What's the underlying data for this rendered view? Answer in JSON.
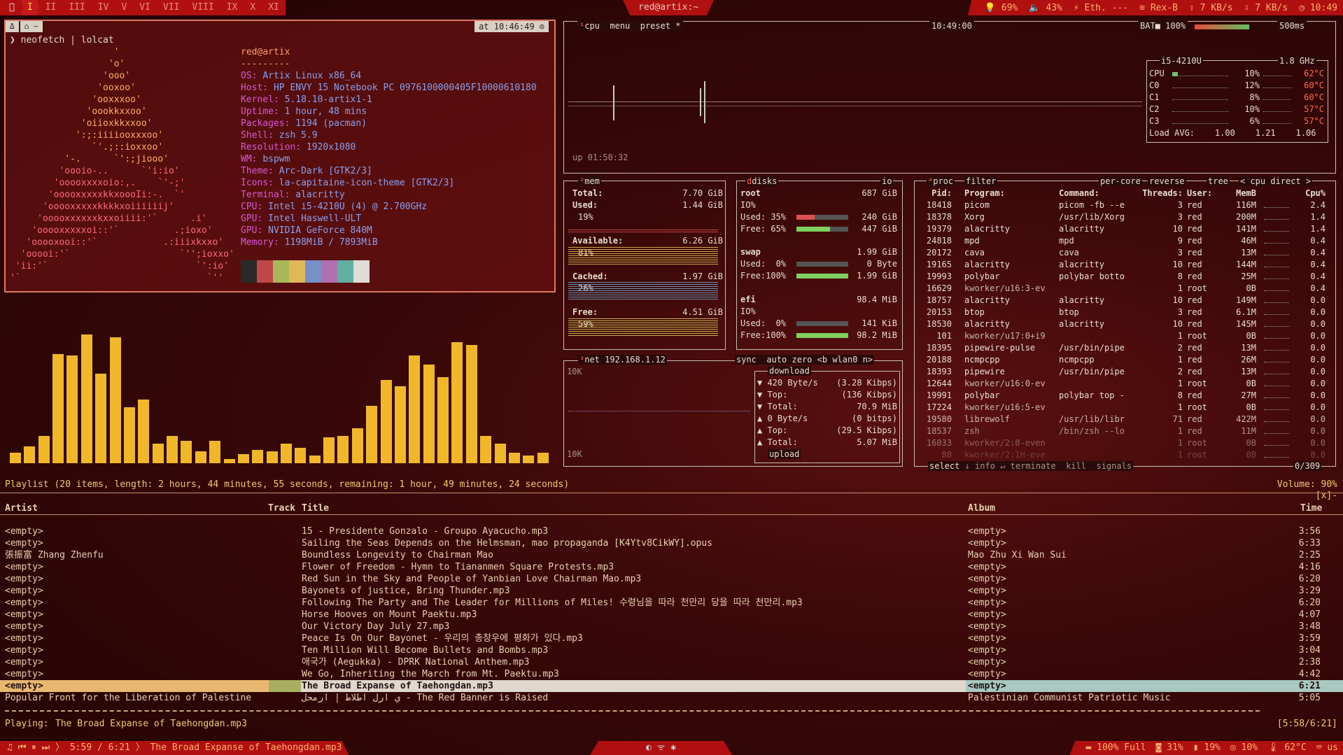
{
  "topbar": {
    "workspace_icon": "󰣇",
    "workspaces": [
      "I",
      "II",
      "III",
      "IV",
      "V",
      "VI",
      "VII",
      "VIII",
      "IX",
      "X",
      "XI"
    ],
    "active_workspace": "I",
    "window_title": "red@artix:~",
    "modules": [
      {
        "icon": "bulb-icon",
        "text": "69%"
      },
      {
        "icon": "speaker-icon",
        "text": "43%"
      },
      {
        "icon": "ethernet-icon",
        "text": "Eth. ---"
      },
      {
        "icon": "wifi-icon",
        "text": "Rex-B"
      },
      {
        "icon": "upload-icon",
        "text": "7 KB/s"
      },
      {
        "icon": "download-icon",
        "text": "7 KB/s"
      },
      {
        "icon": "clock-icon",
        "text": "10:49"
      }
    ]
  },
  "neofetch": {
    "tab_icons": [
      "Δ",
      "⌂ ~"
    ],
    "time_badge": "at 10:46:49 ⊙",
    "command": "❯ neofetch | lolcat",
    "ascii": [
      "                   '",
      "                  'o'",
      "                 'ooo'",
      "                'ooxoo'",
      "               'ooxxxoo'",
      "              'oookkxxoo'",
      "             'oiioxkkxxoo'",
      "            ':;:iiiiooxxxoo'",
      "               `'.;::ioxxoo'",
      "          '-.      `':;jiooo'",
      "         'oooio-..      `'i:io'",
      "        'ooooxxxxoio:,.    `'-;'",
      "       'ooooxxxxxkkxoooIi:-.  `'",
      "      'ooooxxxxxkkkkxoiiiiiij'",
      "     'ooooxxxxxxkxxoiiii:'`      .i'",
      "    'ooooxxxxxoi::'`          .;ioxo'",
      "   'ooooxooi::'`            .:iiixkxxo'",
      "  'ooooi:'`                    `'';ioxxo'",
      " 'ii:'`                           `':io'",
      "'`                                  `''"
    ],
    "user": "red@artix",
    "separator": "---------",
    "info": [
      {
        "k": "OS:",
        "v": "Artix Linux x86_64"
      },
      {
        "k": "Host:",
        "v": "HP ENVY 15 Notebook PC 0976100000405F10000610180"
      },
      {
        "k": "Kernel:",
        "v": "5.18.10-artix1-1"
      },
      {
        "k": "Uptime:",
        "v": "1 hour, 48 mins"
      },
      {
        "k": "Packages:",
        "v": "1194 (pacman)"
      },
      {
        "k": "Shell:",
        "v": "zsh 5.9"
      },
      {
        "k": "Resolution:",
        "v": "1920x1080"
      },
      {
        "k": "WM:",
        "v": "bspwm"
      },
      {
        "k": "Theme:",
        "v": "Arc-Dark [GTK2/3]"
      },
      {
        "k": "Icons:",
        "v": "la-capitaine-icon-theme [GTK2/3]"
      },
      {
        "k": "Terminal:",
        "v": "alacritty"
      },
      {
        "k": "CPU:",
        "v": "Intel i5-4210U (4) @ 2.700GHz"
      },
      {
        "k": "GPU:",
        "v": "Intel Haswell-ULT"
      },
      {
        "k": "GPU:",
        "v": "NVIDIA GeForce 840M"
      },
      {
        "k": "Memory:",
        "v": "1198MiB / 7893MiB"
      }
    ],
    "palette": [
      "#2a2a2a",
      "#c04848",
      "#a8b858",
      "#e0b858",
      "#7890c8",
      "#b070b0",
      "#60b0a0",
      "#e0dcd8"
    ]
  },
  "cava": {
    "bars": [
      0.07,
      0.11,
      0.18,
      0.72,
      0.71,
      0.85,
      0.59,
      0.83,
      0.37,
      0.42,
      0.13,
      0.18,
      0.15,
      0.08,
      0.15,
      0.03,
      0.06,
      0.09,
      0.08,
      0.13,
      0.1,
      0.05,
      0.17,
      0.18,
      0.23,
      0.38,
      0.55,
      0.51,
      0.71,
      0.65,
      0.57,
      0.8,
      0.78,
      0.18,
      0.13,
      0.07,
      0.05,
      0.07
    ]
  },
  "btop": {
    "cpu_header": {
      "tabs": [
        "cpu",
        "menu",
        "preset *"
      ],
      "time": "10:49:00",
      "battery": "BAT■ 100%",
      "interval": "500ms"
    },
    "uptime": "up 01:50:32",
    "cpu_box": {
      "model": "i5-4210U",
      "freq": "1.8 GHz",
      "rows": [
        {
          "name": "CPU",
          "pct": "10%",
          "temp": "62°C"
        },
        {
          "name": "C0",
          "pct": "12%",
          "temp": "60°C"
        },
        {
          "name": "C1",
          "pct": "8%",
          "temp": "60°C"
        },
        {
          "name": "C2",
          "pct": "10%",
          "temp": "57°C"
        },
        {
          "name": "C3",
          "pct": "6%",
          "temp": "57°C"
        }
      ],
      "load": "Load AVG:    1.00    1.21    1.06"
    },
    "mem": {
      "title": "mem",
      "total_label": "Total:",
      "total": "7.70 GiB",
      "used_label": "Used:",
      "used": "1.44 GiB",
      "used_pct": "19%",
      "avail_label": "Available:",
      "avail": "6.26 GiB",
      "avail_pct": "81%",
      "cached_label": "Cached:",
      "cached": "1.97 GiB",
      "cached_pct": "26%",
      "free_label": "Free:",
      "free": "4.51 GiB",
      "free_pct": "59%"
    },
    "disks": {
      "title": "disks",
      "io": "io",
      "root": {
        "name": "root",
        "size": "687 GiB",
        "io": "IO%",
        "used": "Used: 35%",
        "used_v": "240 GiB",
        "free": "Free: 65%",
        "free_v": "447 GiB"
      },
      "swap": {
        "name": "swap",
        "size": "1.99 GiB",
        "used": "Used:  0%",
        "used_v": "0 Byte",
        "free": "Free:100%",
        "free_v": "1.99 GiB"
      },
      "efi": {
        "name": "efi",
        "size": "98.4 MiB",
        "io": "IO%",
        "used": "Used:  0%",
        "used_v": "141 KiB",
        "free": "Free:100%",
        "free_v": "98.2 MiB"
      }
    },
    "net": {
      "title": "net",
      "ip": "192.168.1.12",
      "opts": [
        "sync",
        "auto",
        "zero",
        "<b wlan0 n>"
      ],
      "scale_top": "10K",
      "scale_bot": "10K",
      "download": "download",
      "rows": [
        {
          "k": "▼ 420 Byte/s",
          "v": "(3.28 Kibps)"
        },
        {
          "k": "▼ Top:",
          "v": "(136 Kibps)"
        },
        {
          "k": "▼ Total:",
          "v": "70.9 MiB"
        },
        {
          "k": "▲ 0 Byte/s",
          "v": "(0 bitps)"
        },
        {
          "k": "▲ Top:",
          "v": "(29.5 Kibps)"
        },
        {
          "k": "▲ Total:",
          "v": "5.07 MiB"
        }
      ],
      "upload": "upload"
    },
    "proc": {
      "tabs": [
        "proc",
        "filter",
        "per-core",
        "reverse",
        "tree",
        "< cpu direct >"
      ],
      "headers": [
        "Pid:",
        "Program:",
        "Command:",
        "Threads:",
        "User:",
        "MemB",
        "Cpu%"
      ],
      "rows": [
        [
          "18418",
          "picom",
          "picom -fb --e",
          "3",
          "red",
          "116M",
          "2.4"
        ],
        [
          "18378",
          "Xorg",
          "/usr/lib/Xorg",
          "3",
          "red",
          "200M",
          "1.4"
        ],
        [
          "19379",
          "alacritty",
          "alacritty",
          "10",
          "red",
          "141M",
          "1.4"
        ],
        [
          "24818",
          "mpd",
          "mpd",
          "9",
          "red",
          "46M",
          "0.4"
        ],
        [
          "20172",
          "cava",
          "cava",
          "3",
          "red",
          "13M",
          "0.4"
        ],
        [
          "19165",
          "alacritty",
          "alacritty",
          "10",
          "red",
          "144M",
          "0.4"
        ],
        [
          "19993",
          "polybar",
          "polybar botto",
          "8",
          "red",
          "25M",
          "0.4"
        ],
        [
          "16629",
          "kworker/u16:3-ev",
          "",
          "1",
          "root",
          "0B",
          "0.4"
        ],
        [
          "18757",
          "alacritty",
          "alacritty",
          "10",
          "red",
          "149M",
          "0.0"
        ],
        [
          "20153",
          "btop",
          "btop",
          "3",
          "red",
          "6.1M",
          "0.0"
        ],
        [
          "18530",
          "alacritty",
          "alacritty",
          "10",
          "red",
          "145M",
          "0.0"
        ],
        [
          "101",
          "kworker/u17:0+i9",
          "",
          "1",
          "root",
          "0B",
          "0.0"
        ],
        [
          "18395",
          "pipewire-pulse",
          "/usr/bin/pipe",
          "2",
          "red",
          "13M",
          "0.0"
        ],
        [
          "20188",
          "ncmpcpp",
          "ncmpcpp",
          "1",
          "red",
          "26M",
          "0.0"
        ],
        [
          "18393",
          "pipewire",
          "/usr/bin/pipe",
          "2",
          "red",
          "13M",
          "0.0"
        ],
        [
          "12644",
          "kworker/u16:0-ev",
          "",
          "1",
          "root",
          "0B",
          "0.0"
        ],
        [
          "19991",
          "polybar",
          "polybar top -",
          "8",
          "red",
          "27M",
          "0.0"
        ],
        [
          "17224",
          "kworker/u16:5-ev",
          "",
          "1",
          "root",
          "0B",
          "0.0"
        ],
        [
          "19580",
          "librewolf",
          "/usr/lib/libr",
          "71",
          "red",
          "422M",
          "0.0"
        ],
        [
          "18537",
          "zsh",
          "/bin/zsh --lo",
          "1",
          "red",
          "11M",
          "0.0"
        ],
        [
          "16033",
          "kworker/2:0-even",
          "",
          "1",
          "root",
          "0B",
          "0.0"
        ],
        [
          "88",
          "kworker/2:1H-eve",
          "",
          "1",
          "root",
          "0B",
          "0.0"
        ]
      ],
      "footer": [
        "select",
        "info",
        "terminate",
        "kill",
        "signals"
      ],
      "count": "0/309"
    }
  },
  "playlist": {
    "summary": "Playlist (20 items, length: 2 hours, 44 minutes, 55 seconds, remaining: 1 hour, 49 minutes, 24 seconds)",
    "volume": "Volume: 90%",
    "flags": "[x]-",
    "headers": {
      "artist": "Artist",
      "track": "Track",
      "title": "Title",
      "album": "Album",
      "time": "Time"
    },
    "rows": [
      {
        "artist": "<empty>",
        "title": "15 - Presidente Gonzalo - Groupo Ayacucho.mp3",
        "album": "<empty>",
        "time": "3:56"
      },
      {
        "artist": "<empty>",
        "title": "Sailing the Seas Depends on the Helmsman, mao propaganda [K4Ytv8CikWY].opus",
        "album": "<empty>",
        "time": "6:33"
      },
      {
        "artist": "張振富 Zhang Zhenfu",
        "title": "Boundless Longevity to Chairman Mao",
        "album": "Mao Zhu Xi Wan Sui",
        "time": "2:25"
      },
      {
        "artist": "<empty>",
        "title": "Flower of Freedom - Hymn to Tiananmen Square Protests.mp3",
        "album": "<empty>",
        "time": "4:16"
      },
      {
        "artist": "<empty>",
        "title": "Red Sun in the Sky and People of Yanbian Love Chairman Mao.mp3",
        "album": "<empty>",
        "time": "6:20"
      },
      {
        "artist": "<empty>",
        "title": "Bayonets of justice, Bring Thunder.mp3",
        "album": "<empty>",
        "time": "3:29"
      },
      {
        "artist": "<empty>",
        "title": "Following The Party and The Leader for Millions of Miles! 수령님을 따라 천만리 당을 따라 천만리.mp3",
        "album": "<empty>",
        "time": "6:20"
      },
      {
        "artist": "<empty>",
        "title": "Horse Hooves on Mount Paektu.mp3",
        "album": "<empty>",
        "time": "4:07"
      },
      {
        "artist": "<empty>",
        "title": "Our Victory Day July 27.mp3",
        "album": "<empty>",
        "time": "3:48"
      },
      {
        "artist": "<empty>",
        "title": "Peace Is On Our Bayonet - 우리의 총창우에 평화가 있다.mp3",
        "album": "<empty>",
        "time": "3:59"
      },
      {
        "artist": "<empty>",
        "title": "Ten Million Will Become Bullets and Bombs.mp3",
        "album": "<empty>",
        "time": "3:04"
      },
      {
        "artist": "<empty>",
        "title": "애국가 (Aegukka) - DPRK National Anthem.mp3",
        "album": "<empty>",
        "time": "2:38"
      },
      {
        "artist": "<empty>",
        "title": "We Go, Inheriting the March from Mt. Paektu.mp3",
        "album": "<empty>",
        "time": "4:42"
      },
      {
        "artist": "<empty>",
        "title": "The Broad Expanse of Taehongdan.mp3",
        "album": "<empty>",
        "time": "6:21"
      },
      {
        "artist": "Popular Front for the Liberation of Palestine",
        "title": "ي ارل اطلاط | ارمحل - The Red Banner is Raised",
        "album": "Palestinian Communist Patriotic Music",
        "time": "5:05"
      }
    ],
    "highlight_index": 13,
    "playing_label": "Playing:",
    "playing": "The Broad Expanse of Taehongdan.mp3",
    "progress": "[5:58/6:21]",
    "progress_fraction": 0.94
  },
  "bottombar": {
    "player": "♫  ⏮ ⏸ ⏭ 〉 5:59 / 6:21 〉 The Broad Expanse of Taehongdan.mp3",
    "tray": "◐ ᯤ ✱",
    "modules": [
      {
        "icon": "battery-icon",
        "text": "100% Full"
      },
      {
        "icon": "disk-icon",
        "text": "31%"
      },
      {
        "icon": "memory-icon",
        "text": "19%"
      },
      {
        "icon": "cpu-icon",
        "text": "10%"
      },
      {
        "icon": "thermometer-icon",
        "text": "62°C"
      },
      {
        "icon": "keyboard-icon",
        "text": "us"
      }
    ]
  },
  "colors": {
    "accent": "#b01010",
    "bar": "#f0b828",
    "border": "#c8c0b0",
    "highlight": "#e8d2b0"
  }
}
